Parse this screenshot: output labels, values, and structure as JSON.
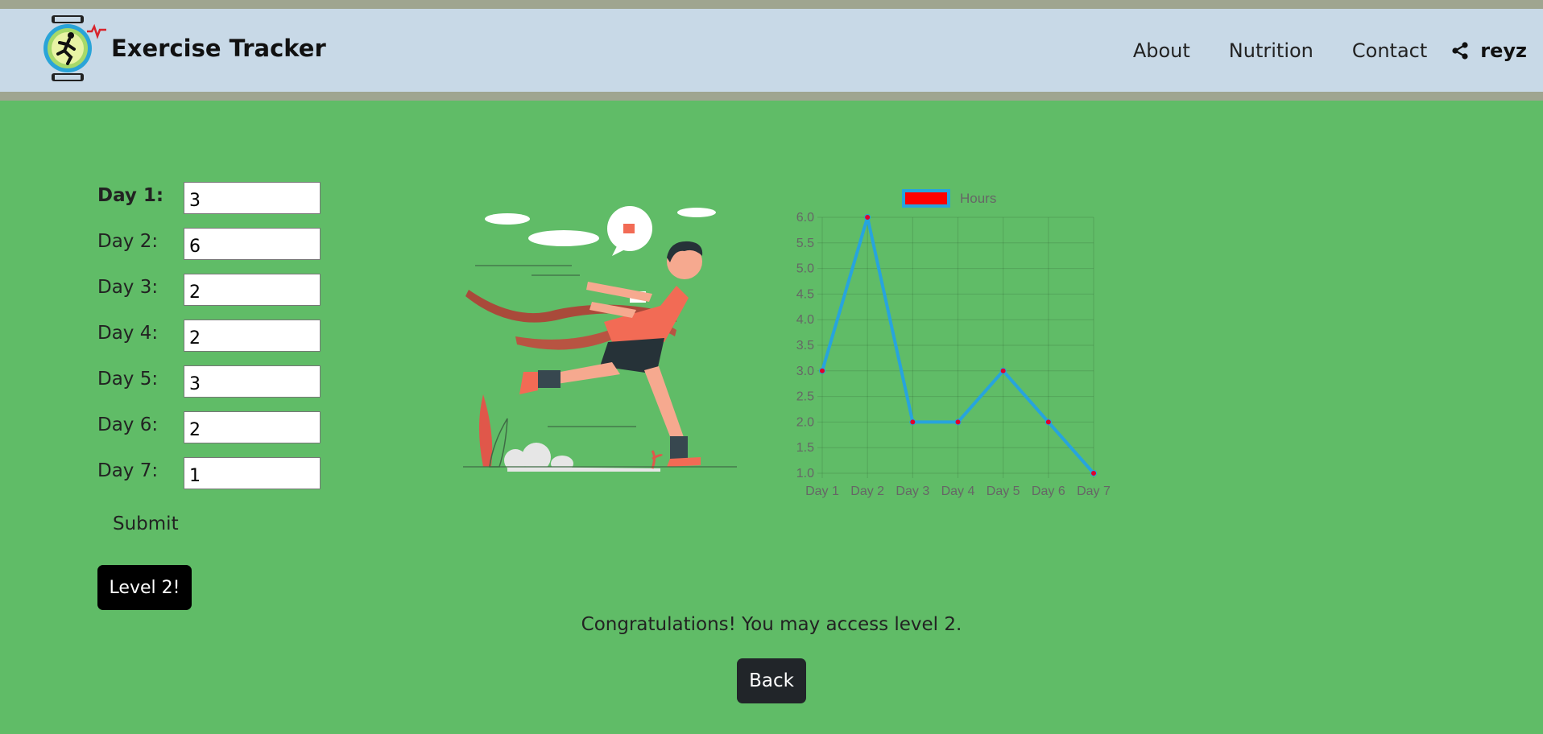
{
  "header": {
    "brand_title": "Exercise Tracker",
    "nav": [
      "About",
      "Nutrition",
      "Contact"
    ],
    "user": "reyz",
    "icons": {
      "logo": "running-watch-icon",
      "share": "share-icon"
    }
  },
  "form": {
    "days": [
      {
        "label": "Day 1:",
        "value": "3"
      },
      {
        "label": "Day 2:",
        "value": "6"
      },
      {
        "label": "Day 3:",
        "value": "2"
      },
      {
        "label": "Day 4:",
        "value": "2"
      },
      {
        "label": "Day 5:",
        "value": "3"
      },
      {
        "label": "Day 6:",
        "value": "2"
      },
      {
        "label": "Day 7:",
        "value": "1"
      }
    ],
    "submit_label": "Submit",
    "level_label": "Level 2!"
  },
  "chart_data": {
    "type": "line",
    "categories": [
      "Day 1",
      "Day 2",
      "Day 3",
      "Day 4",
      "Day 5",
      "Day 6",
      "Day 7"
    ],
    "series": [
      {
        "name": "Hours",
        "values": [
          3,
          6,
          2,
          2,
          3,
          2,
          1
        ],
        "color": "#27a4dd",
        "point_color": "#e0002a",
        "legend_fill": "#ff0000"
      }
    ],
    "ylim": [
      1,
      6
    ],
    "yticks": [
      "1.0",
      "1.5",
      "2.0",
      "2.5",
      "3.0",
      "3.5",
      "4.0",
      "4.5",
      "5.0",
      "5.5",
      "6.0"
    ],
    "grid": true,
    "legend_position": "top"
  },
  "message": "Congratulations! You may access level 2.",
  "back_label": "Back",
  "colors": {
    "background": "#60bc67",
    "navbar": "#c8d9e7",
    "stripe": "#9fa590"
  }
}
